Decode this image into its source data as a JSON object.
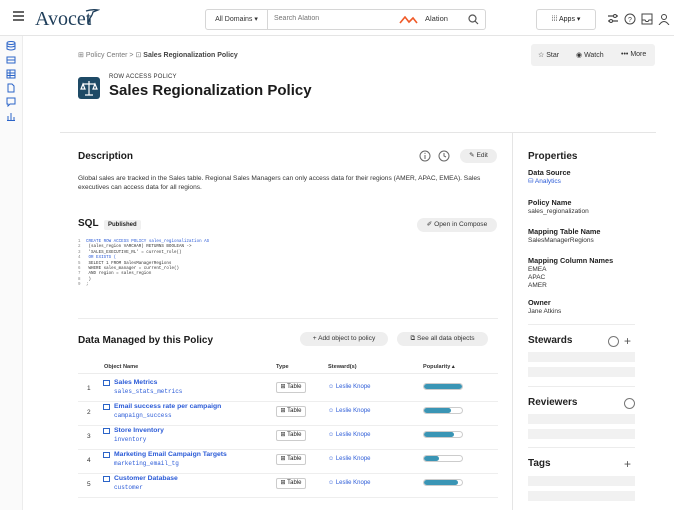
{
  "top": {
    "brand": "Avocet",
    "domains": "All Domains",
    "search_placeholder": "Search Alation",
    "search_brand": "Alation",
    "apps": "Apps"
  },
  "breadcrumb": {
    "root": "Policy Center",
    "sep": ">",
    "current": "Sales Regionalization Policy"
  },
  "header": {
    "kind": "ROW ACCESS POLICY",
    "title": "Sales Regionalization Policy",
    "star": "Star",
    "watch": "Watch",
    "more": "More"
  },
  "description": {
    "heading": "Description",
    "edit": "Edit",
    "text": "Global sales are tracked in the Sales table. Regional Sales Managers can only access data for their regions (AMER, APAC, EMEA). Sales executives can access data for all regions."
  },
  "sql": {
    "heading": "SQL",
    "badge": "Published",
    "compose": "Open in Compose",
    "lines": [
      {
        "n": "1",
        "t": "CREATE ROW ACCESS POLICY sales_regionalization AS"
      },
      {
        "n": "2",
        "t": "  (sales_region VARCHAR) RETURNS BOOLEAN ->"
      },
      {
        "n": "3",
        "t": "  'SALES_EXECUTIVE_RL' = current_role()"
      },
      {
        "n": "4",
        "t": "      OR EXISTS ("
      },
      {
        "n": "5",
        "t": "          SELECT 1 FROM SalesManagerRegions"
      },
      {
        "n": "6",
        "t": "            WHERE sales_manager = current_role()"
      },
      {
        "n": "7",
        "t": "              AND region = sales_region"
      },
      {
        "n": "8",
        "t": "          )"
      },
      {
        "n": "9",
        "t": ";"
      }
    ]
  },
  "data_managed": {
    "heading": "Data Managed by this Policy",
    "add": "Add object to policy",
    "see_all": "See all data objects",
    "columns": {
      "name": "Object Name",
      "type": "Type",
      "stewards": "Steward(s)",
      "popularity": "Popularity"
    },
    "rows": [
      {
        "n": "1",
        "name": "Sales Metrics",
        "tech": "sales_stats_metrics",
        "type": "Table",
        "steward": "Leslie Knope",
        "pop": 1.0
      },
      {
        "n": "2",
        "name": "Email success rate per campaign",
        "tech": "campaign_success",
        "type": "Table",
        "steward": "Leslie Knope",
        "pop": 0.7
      },
      {
        "n": "3",
        "name": "Store Inventory",
        "tech": "inventory",
        "type": "Table",
        "steward": "Leslie Knope",
        "pop": 0.8
      },
      {
        "n": "4",
        "name": "Marketing Email Campaign Targets",
        "tech": "marketing_email_tg",
        "type": "Table",
        "steward": "Leslie Knope",
        "pop": 0.4
      },
      {
        "n": "5",
        "name": "Customer Database",
        "tech": "customer",
        "type": "Table",
        "steward": "Leslie Knope",
        "pop": 0.9
      }
    ]
  },
  "properties": {
    "heading": "Properties",
    "ds_label": "Data Source",
    "ds_value": "Analytics",
    "pn_label": "Policy Name",
    "pn_value": "sales_regionalization",
    "mt_label": "Mapping Table Name",
    "mt_value": "SalesManagerRegions",
    "mc_label": "Mapping Column Names",
    "mc_values": [
      "EMEA",
      "APAC",
      "AMER"
    ],
    "owner_label": "Owner",
    "owner_value": "Jane Atkins",
    "stewards": "Stewards",
    "reviewers": "Reviewers",
    "tags": "Tags"
  },
  "colors": {
    "accent": "#2b5bd7",
    "navy": "#1e4a66",
    "pop": "#3a95b5",
    "brand_orange": "#f05a28"
  }
}
